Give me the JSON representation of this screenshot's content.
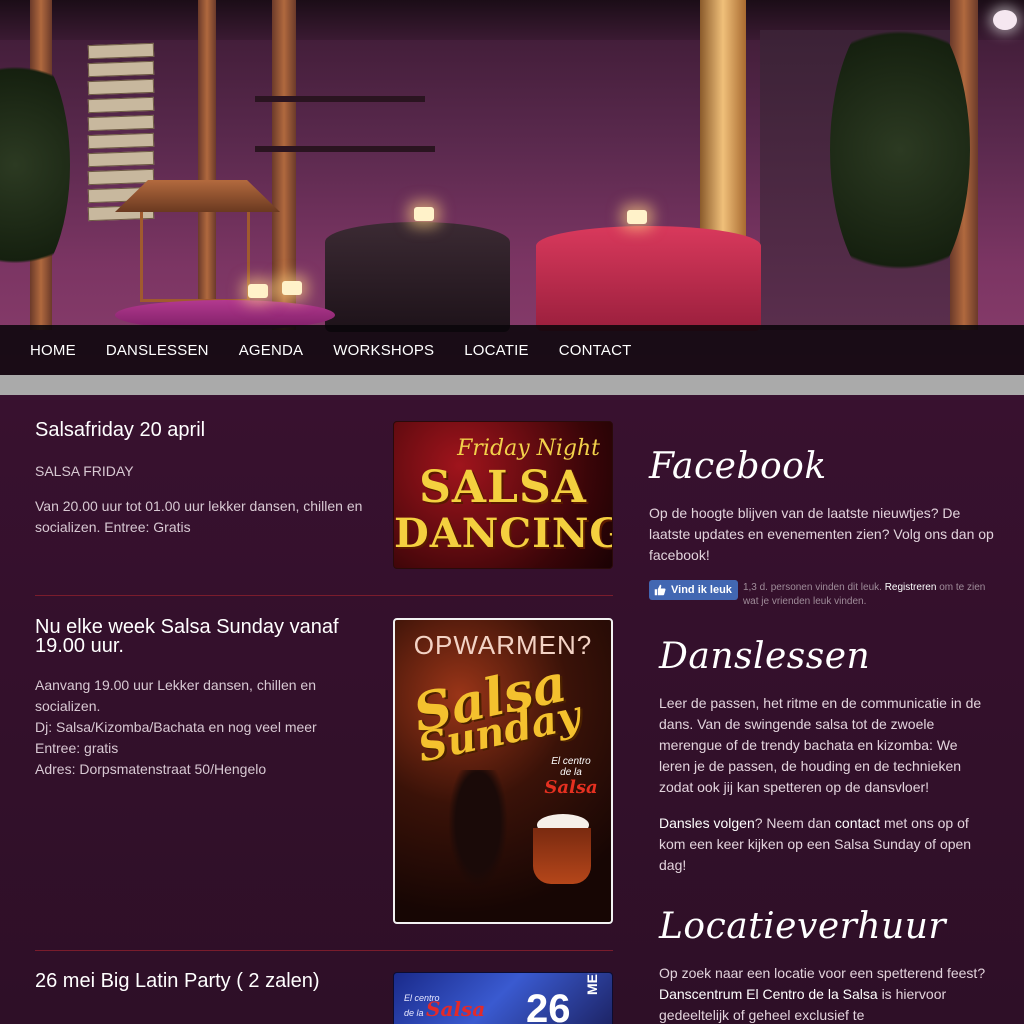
{
  "nav": {
    "items": [
      "HOME",
      "DANSLESSEN",
      "AGENDA",
      "WORKSHOPS",
      "LOCATIE",
      "CONTACT"
    ]
  },
  "posts": [
    {
      "title": "Salsafriday 20 april",
      "subtitle": "SALSA FRIDAY",
      "body": "Van 20.00 uur tot 01.00 uur lekker dansen, chillen en socializen. Entree: Gratis",
      "image": {
        "line1": "Friday Night",
        "line2": "SALSA",
        "line3": "DANCING"
      }
    },
    {
      "title_line1": "Nu elke week Salsa Sunday vanaf",
      "title_line2": "19.00 uur.",
      "lines": [
        "Aanvang 19.00 uur Lekker dansen, chillen en socializen.",
        "Dj: Salsa/Kizomba/Bachata en nog veel meer",
        "Entree: gratis",
        "Adres: Dorpsmatenstraat 50/Hengelo"
      ],
      "image": {
        "top": "OPWARMEN?",
        "word1": "Salsa",
        "word2": "Sunday",
        "brand_small1": "El centro",
        "brand_small2": "de la",
        "brand": "Salsa"
      }
    },
    {
      "title": "26 mei Big Latin Party ( 2 zalen)",
      "image": {
        "brand_small1": "El centro",
        "brand_small2": "de la",
        "brand": "Salsa",
        "day": "26",
        "month": "MEI"
      }
    }
  ],
  "facebook": {
    "title": "Facebook",
    "text": "Op de hoogte blijven van de laatste nieuwtjes? De laatste updates en evenementen zien? Volg ons dan op facebook!",
    "like_label": "Vind ik leuk",
    "count_text_pre": "1,3 d. personen vinden dit leuk.",
    "register_link": "Registreren",
    "count_text_post": "om te zien wat je vrienden leuk vinden.",
    "color": "#4267b2"
  },
  "danslessen": {
    "title": "Danslessen",
    "text": "Leer de passen, het ritme en de communicatie in de dans. Van de swingende salsa tot de zwoele merengue of de trendy bachata en kizomba: We leren je de passen, de houding en de technieken zodat ook jij kan spetteren op de dansvloer!",
    "link1": "Dansles volgen",
    "text2a": "? Neem dan",
    "link2": "contact",
    "text2b": "met ons op of kom een keer kijken op een Salsa Sunday of open dag!"
  },
  "locatieverhuur": {
    "title": "Locatieverhuur",
    "text_a": "Op zoek naar een locatie voor een spetterend feest?",
    "link": "Danscentrum El Centro de la Salsa",
    "text_b": "is hiervoor gedeeltelijk of geheel exclusief te"
  },
  "colors": {
    "background": "#2e0f27",
    "nav_bg": "#0a060a",
    "divider": "#7a1c2c",
    "grey_band": "#aaaaaa"
  }
}
